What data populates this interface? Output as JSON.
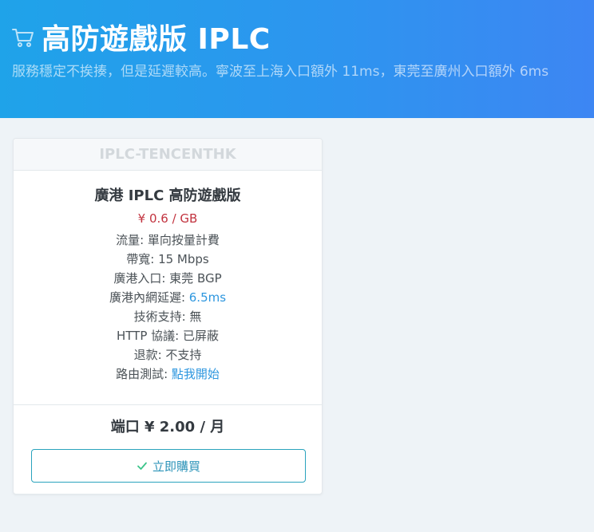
{
  "header": {
    "title": "高防遊戲版 IPLC",
    "subtitle": "服務穩定不挨揍，但是延遲較高。寧波至上海入口額外 11ms，東莞至廣州入口額外 6ms",
    "icon": "cart-icon"
  },
  "card": {
    "header": "IPLC-TENCENTHK",
    "product_name": "廣港 IPLC 高防遊戲版",
    "price_per_gb": "¥ 0.6 / GB",
    "specs": [
      {
        "label": "流量: ",
        "value": "單向按量計費"
      },
      {
        "label": "帶寬: ",
        "value": "15 Mbps"
      },
      {
        "label": "廣港入口: ",
        "value": "東莞 BGP"
      },
      {
        "label": "廣港內網延遲: ",
        "value": "6.5ms"
      },
      {
        "label": "技術支持: ",
        "value": "無"
      },
      {
        "label": "HTTP 協議: ",
        "value": "已屏蔽"
      },
      {
        "label": "退款: ",
        "value": "不支持"
      },
      {
        "label": "路由測試: ",
        "value": "點我開始"
      }
    ],
    "monthly_price": "端口 ¥ 2.00 / 月",
    "buy_label": "立即購買"
  },
  "colors": {
    "header_gradient_start": "#1fa3e9",
    "header_gradient_end": "#3d86f3",
    "price_red": "#c2333f",
    "link_blue": "#2e97df",
    "button_border": "#2aa3bd",
    "check_green": "#3cc48a"
  }
}
